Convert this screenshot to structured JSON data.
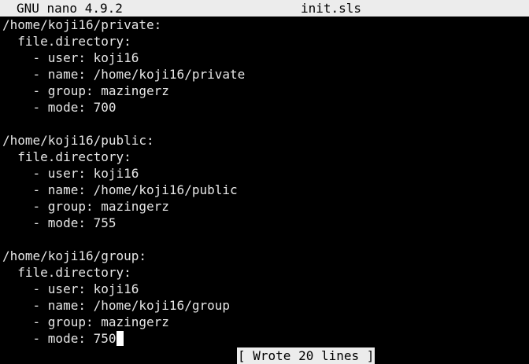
{
  "window": {
    "app_version": "GNU nano 4.9.2",
    "filename": "init.sls"
  },
  "editor": {
    "lines": [
      "/home/koji16/private:",
      "  file.directory:",
      "    - user: koji16",
      "    - name: /home/koji16/private",
      "    - group: mazingerz",
      "    - mode: 700",
      "",
      "/home/koji16/public:",
      "  file.directory:",
      "    - user: koji16",
      "    - name: /home/koji16/public",
      "    - group: mazingerz",
      "    - mode: 755",
      "",
      "/home/koji16/group:",
      "  file.directory:",
      "    - user: koji16",
      "    - name: /home/koji16/group",
      "    - group: mazingerz",
      "    - mode: 750"
    ]
  },
  "status": {
    "message": "[ Wrote 20 lines ]"
  },
  "colors": {
    "background": "#000000",
    "text": "#e6e6e6",
    "bar": "#ececec",
    "bar_text": "#000000"
  }
}
